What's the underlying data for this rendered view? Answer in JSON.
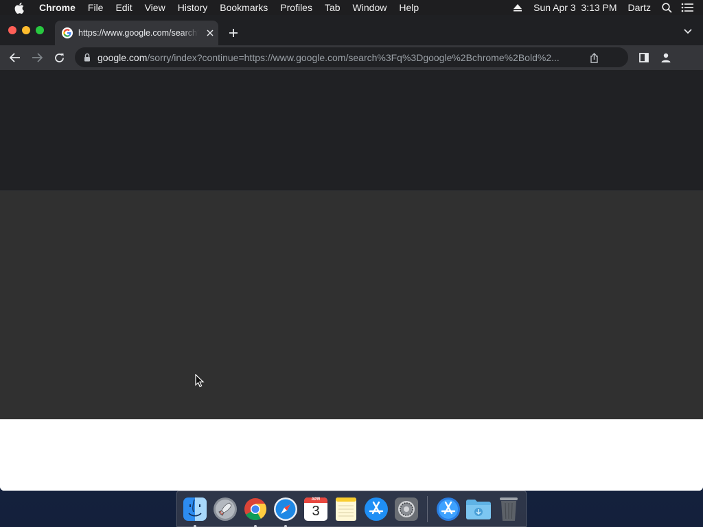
{
  "menubar": {
    "app_name": "Chrome",
    "items": [
      "File",
      "Edit",
      "View",
      "History",
      "Bookmarks",
      "Profiles",
      "Tab",
      "Window",
      "Help"
    ],
    "clock": "Sun Apr 3  3:13 PM",
    "user": "Dartz"
  },
  "browser": {
    "tab": {
      "title": "https://www.google.com/search?q=google+chrome+old",
      "favicon": "google-g-icon"
    },
    "omnibox": {
      "host": "google.com",
      "path": "/sorry/index?continue=https://www.google.com/search%3Fq%3Dgoogle%2Bchrome%2Bold%2..."
    }
  },
  "dock": {
    "calendar_month": "APR",
    "calendar_day": "3",
    "apps": [
      "Finder",
      "Launchpad",
      "Google Chrome",
      "Safari",
      "Calendar",
      "Notes",
      "App Store",
      "System Preferences",
      "App Store",
      "Downloads",
      "Trash"
    ]
  },
  "colors": {
    "menubar_bg": "#1e1e20",
    "tabstrip_bg": "#1f2023",
    "toolbar_bg": "#35363a",
    "omnibox_bg": "#202124",
    "page_top_band": "#202124",
    "page_mid_band": "#303030"
  }
}
